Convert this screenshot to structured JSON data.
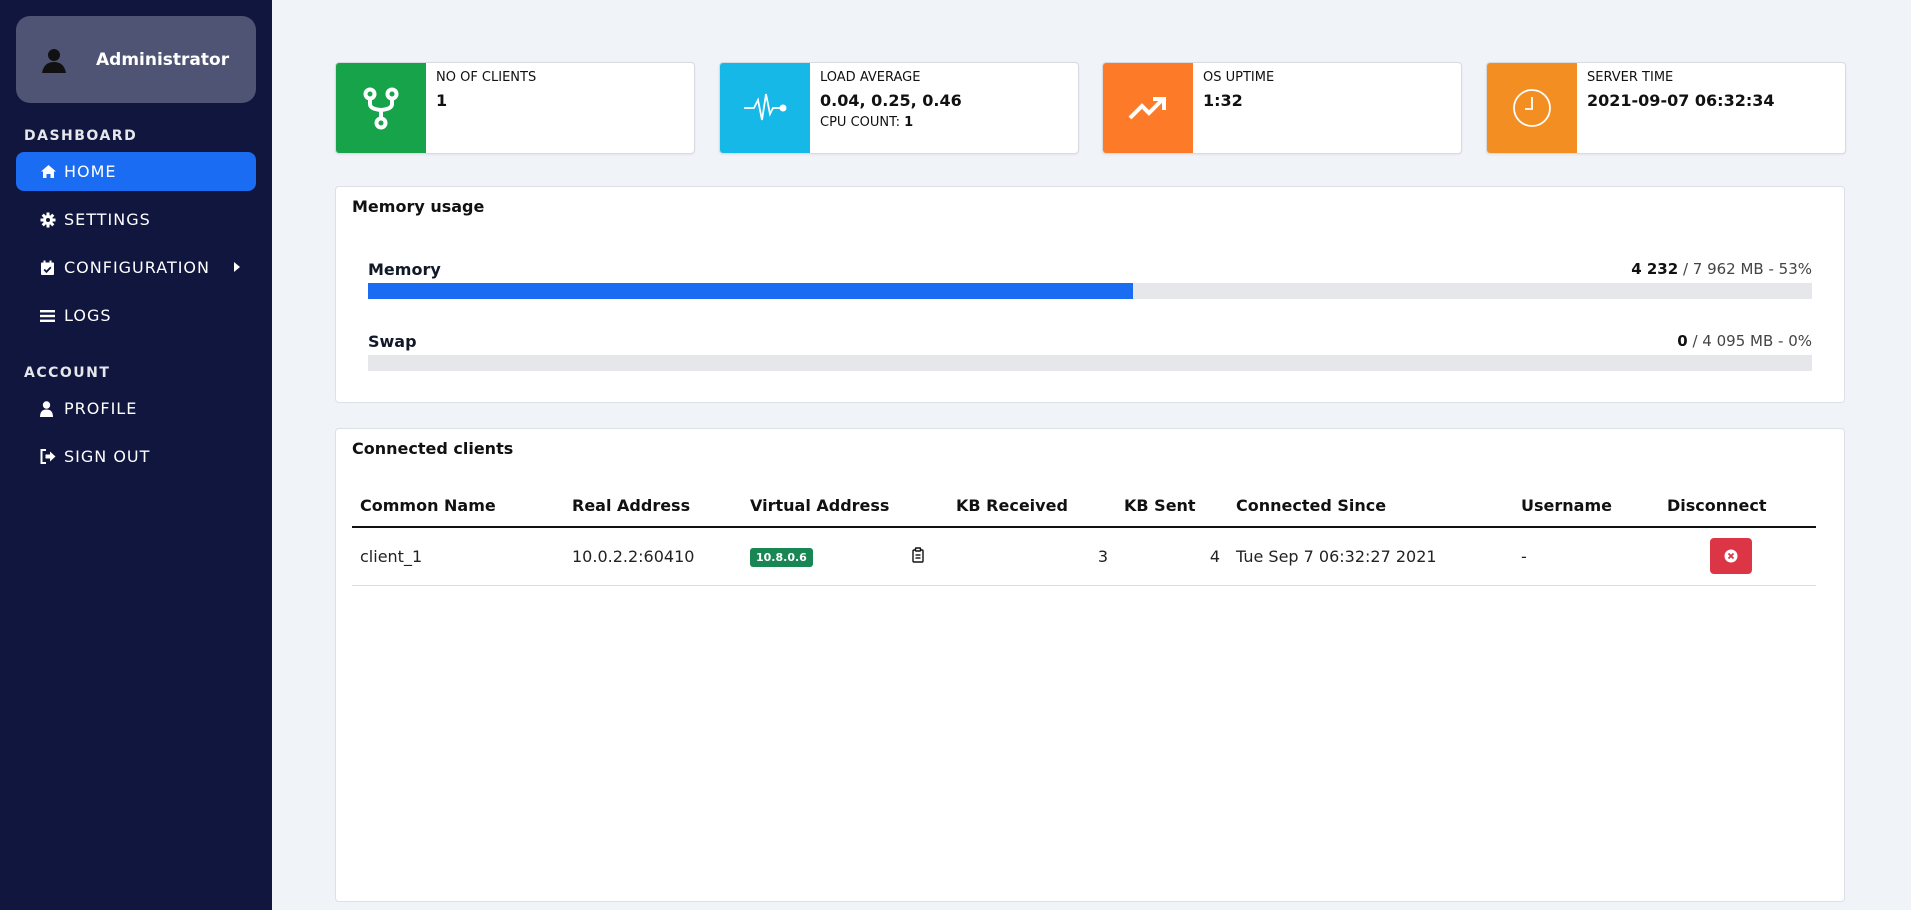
{
  "user": {
    "name": "Administrator"
  },
  "sidebar": {
    "sections": {
      "dashboard": "DASHBOARD",
      "account": "ACCOUNT"
    },
    "items": [
      {
        "label": "HOME",
        "icon": "home-icon",
        "active": true
      },
      {
        "label": "SETTINGS",
        "icon": "gear-icon"
      },
      {
        "label": "CONFIGURATION",
        "icon": "calendar-check-icon"
      },
      {
        "label": "LOGS",
        "icon": "list-icon"
      },
      {
        "label": "PROFILE",
        "icon": "user-icon"
      },
      {
        "label": "SIGN OUT",
        "icon": "sign-out-icon"
      }
    ]
  },
  "stats": {
    "clients": {
      "label": "NO OF CLIENTS",
      "value": "1",
      "color": "#16a34a",
      "icon": "code-fork-icon"
    },
    "load": {
      "label": "LOAD AVERAGE",
      "value": "0.04, 0.25, 0.46",
      "sub_label": "CPU COUNT:",
      "sub_value": "1",
      "color": "#16b8e8",
      "icon": "heartbeat-icon"
    },
    "uptime": {
      "label": "OS UPTIME",
      "value": "1:32",
      "color": "#fd7b28",
      "icon": "trending-up-icon"
    },
    "servertime": {
      "label": "SERVER TIME",
      "value": "2021-09-07 06:32:34",
      "color": "#f38e22",
      "icon": "clock-icon"
    }
  },
  "memory": {
    "title": "Memory usage",
    "memory": {
      "label": "Memory",
      "used": "4 232",
      "rest": " / 7 962 MB - 53%",
      "percent": 53
    },
    "swap": {
      "label": "Swap",
      "used": "0",
      "rest": " / 4 095 MB - 0%",
      "percent": 0
    }
  },
  "clients": {
    "title": "Connected clients",
    "columns": [
      "Common Name",
      "Real Address",
      "Virtual Address",
      "KB Received",
      "KB Sent",
      "Connected Since",
      "Username",
      "Disconnect"
    ],
    "rows": [
      {
        "common_name": "client_1",
        "real_address": "10.0.2.2:60410",
        "virtual_address": "10.8.0.6",
        "kb_received": "3",
        "kb_sent": "4",
        "connected_since": "Tue Sep 7 06:32:27 2021",
        "username": "-"
      }
    ]
  }
}
